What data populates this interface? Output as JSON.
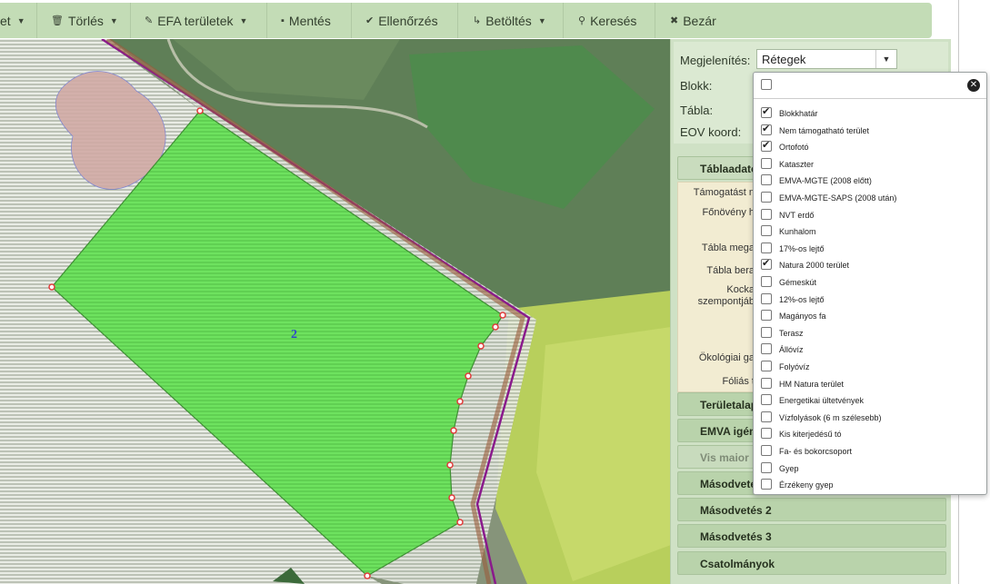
{
  "toolbar": {
    "items": [
      {
        "label": "et",
        "icon": "",
        "caret": true
      },
      {
        "label": "Törlés",
        "icon": "trash-icon",
        "caret": true
      },
      {
        "label": "EFA területek",
        "icon": "pencil-icon",
        "caret": true
      },
      {
        "label": "Mentés",
        "icon": "floppy-icon",
        "caret": false
      },
      {
        "label": "Ellenőrzés",
        "icon": "check-icon",
        "caret": false
      },
      {
        "label": "Betöltés",
        "icon": "arrow-icon",
        "caret": true
      },
      {
        "label": "Keresés",
        "icon": "search-icon",
        "caret": false
      },
      {
        "label": "Bezár",
        "icon": "close-icon",
        "caret": false
      }
    ]
  },
  "map": {
    "parcel_label": "2"
  },
  "panel": {
    "display_label": "Megjelenítés:",
    "display_value": "Rétegek",
    "block_label": "Blokk:",
    "table_label": "Tábla:",
    "eov_label": "EOV koord:",
    "sections": [
      {
        "label": "Táblaadatok",
        "state": "open"
      },
      {
        "label": "Területalap",
        "state": "normal"
      },
      {
        "label": "EMVA igén",
        "state": "normal"
      },
      {
        "label": "Vis maior",
        "state": "disabled"
      },
      {
        "label": "Másodvetés",
        "state": "normal"
      },
      {
        "label": "Másodvetés 2",
        "state": "normal"
      },
      {
        "label": "Másodvetés 3",
        "state": "normal"
      },
      {
        "label": "Csatolmányok",
        "state": "normal"
      }
    ],
    "fields": [
      "Támogatást n",
      "Főnövény h",
      "Tábla mega",
      "Tábla bera",
      "Kocka szempontjáb",
      "Ökológiai ga",
      "Fóliás t"
    ]
  },
  "layers_popup": {
    "all_checked": false,
    "layers": [
      {
        "label": "Blokkhatár",
        "checked": true
      },
      {
        "label": "Nem támogatható terület",
        "checked": true
      },
      {
        "label": "Ortofotó",
        "checked": true
      },
      {
        "label": "Kataszter",
        "checked": false
      },
      {
        "label": "EMVA-MGTE (2008 előtt)",
        "checked": false
      },
      {
        "label": "EMVA-MGTE-SAPS (2008 után)",
        "checked": false
      },
      {
        "label": "NVT erdő",
        "checked": false
      },
      {
        "label": "Kunhalom",
        "checked": false
      },
      {
        "label": "17%-os lejtő",
        "checked": false
      },
      {
        "label": "Natura 2000 terület",
        "checked": true
      },
      {
        "label": "Gémeskút",
        "checked": false
      },
      {
        "label": "12%-os lejtő",
        "checked": false
      },
      {
        "label": "Magányos fa",
        "checked": false
      },
      {
        "label": "Terasz",
        "checked": false
      },
      {
        "label": "Állóvíz",
        "checked": false
      },
      {
        "label": "Folyóvíz",
        "checked": false
      },
      {
        "label": "HM Natura terület",
        "checked": false
      },
      {
        "label": "Energetikai ültetvények",
        "checked": false
      },
      {
        "label": "Vízfolyások (6 m szélesebb)",
        "checked": false
      },
      {
        "label": "Kis kiterjedésű tó",
        "checked": false
      },
      {
        "label": "Fa- és bokorcsoport",
        "checked": false
      },
      {
        "label": "Gyep",
        "checked": false
      },
      {
        "label": "Érzékeny gyep",
        "checked": false
      }
    ]
  },
  "colors": {
    "toolbar_bg": "#c3dcb6",
    "parcel_fill": "#6ee25f",
    "parcel_border": "#3f8f34",
    "block_border": "#8a1a8c",
    "vertex": "#e03a3a"
  }
}
